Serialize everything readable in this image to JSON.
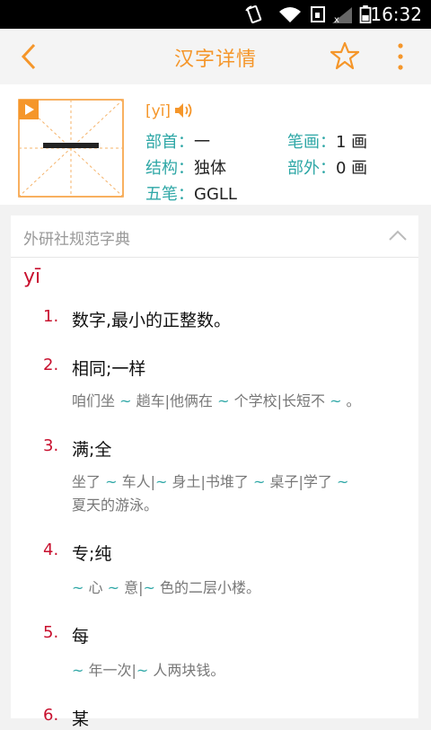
{
  "status_bar": {
    "time": "16:32"
  },
  "app_bar": {
    "title": "汉字详情"
  },
  "character": {
    "glyph": "一",
    "pinyin": "[yī]",
    "attributes": [
      {
        "key": "部首：",
        "value": "一"
      },
      {
        "key": "笔画：",
        "value": "1 画"
      },
      {
        "key": "结构：",
        "value": "独体"
      },
      {
        "key": "部外：",
        "value": "0 画"
      },
      {
        "key": "五笔：",
        "value": "GGLL"
      }
    ]
  },
  "dictionary": {
    "source": "外研社规范字典",
    "pinyin": "yī",
    "entries": [
      {
        "num": "1.",
        "def": "数字,最小的正整数。"
      },
      {
        "num": "2.",
        "def": "相同;一样",
        "example": [
          [
            "咱们坐 ",
            "n"
          ],
          [
            "~",
            "t"
          ],
          [
            " 趟车|他俩在 ",
            "n"
          ],
          [
            "~",
            "t"
          ],
          [
            " 个学校|长短不 ",
            "n"
          ],
          [
            "~",
            "t"
          ],
          [
            " 。",
            "n"
          ]
        ]
      },
      {
        "num": "3.",
        "def": "满;全",
        "example": [
          [
            "坐了 ",
            "n"
          ],
          [
            "~",
            "t"
          ],
          [
            " 车人|",
            "n"
          ],
          [
            "~",
            "t"
          ],
          [
            " 身土|书堆了 ",
            "n"
          ],
          [
            "~",
            "t"
          ],
          [
            " 桌子|学了 ",
            "n"
          ],
          [
            "~",
            "t"
          ],
          [
            " 夏天的游泳。",
            "n"
          ]
        ]
      },
      {
        "num": "4.",
        "def": "专;纯",
        "example": [
          [
            "~",
            "t"
          ],
          [
            " 心 ",
            "n"
          ],
          [
            "~",
            "t"
          ],
          [
            " 意|",
            "n"
          ],
          [
            "~",
            "t"
          ],
          [
            " 色的二层小楼。",
            "n"
          ]
        ]
      },
      {
        "num": "5.",
        "def": "每",
        "example": [
          [
            "~",
            "t"
          ],
          [
            " 年一次|",
            "n"
          ],
          [
            "~",
            "t"
          ],
          [
            " 人两块钱。",
            "n"
          ]
        ]
      },
      {
        "num": "6.",
        "def": "某"
      }
    ]
  }
}
